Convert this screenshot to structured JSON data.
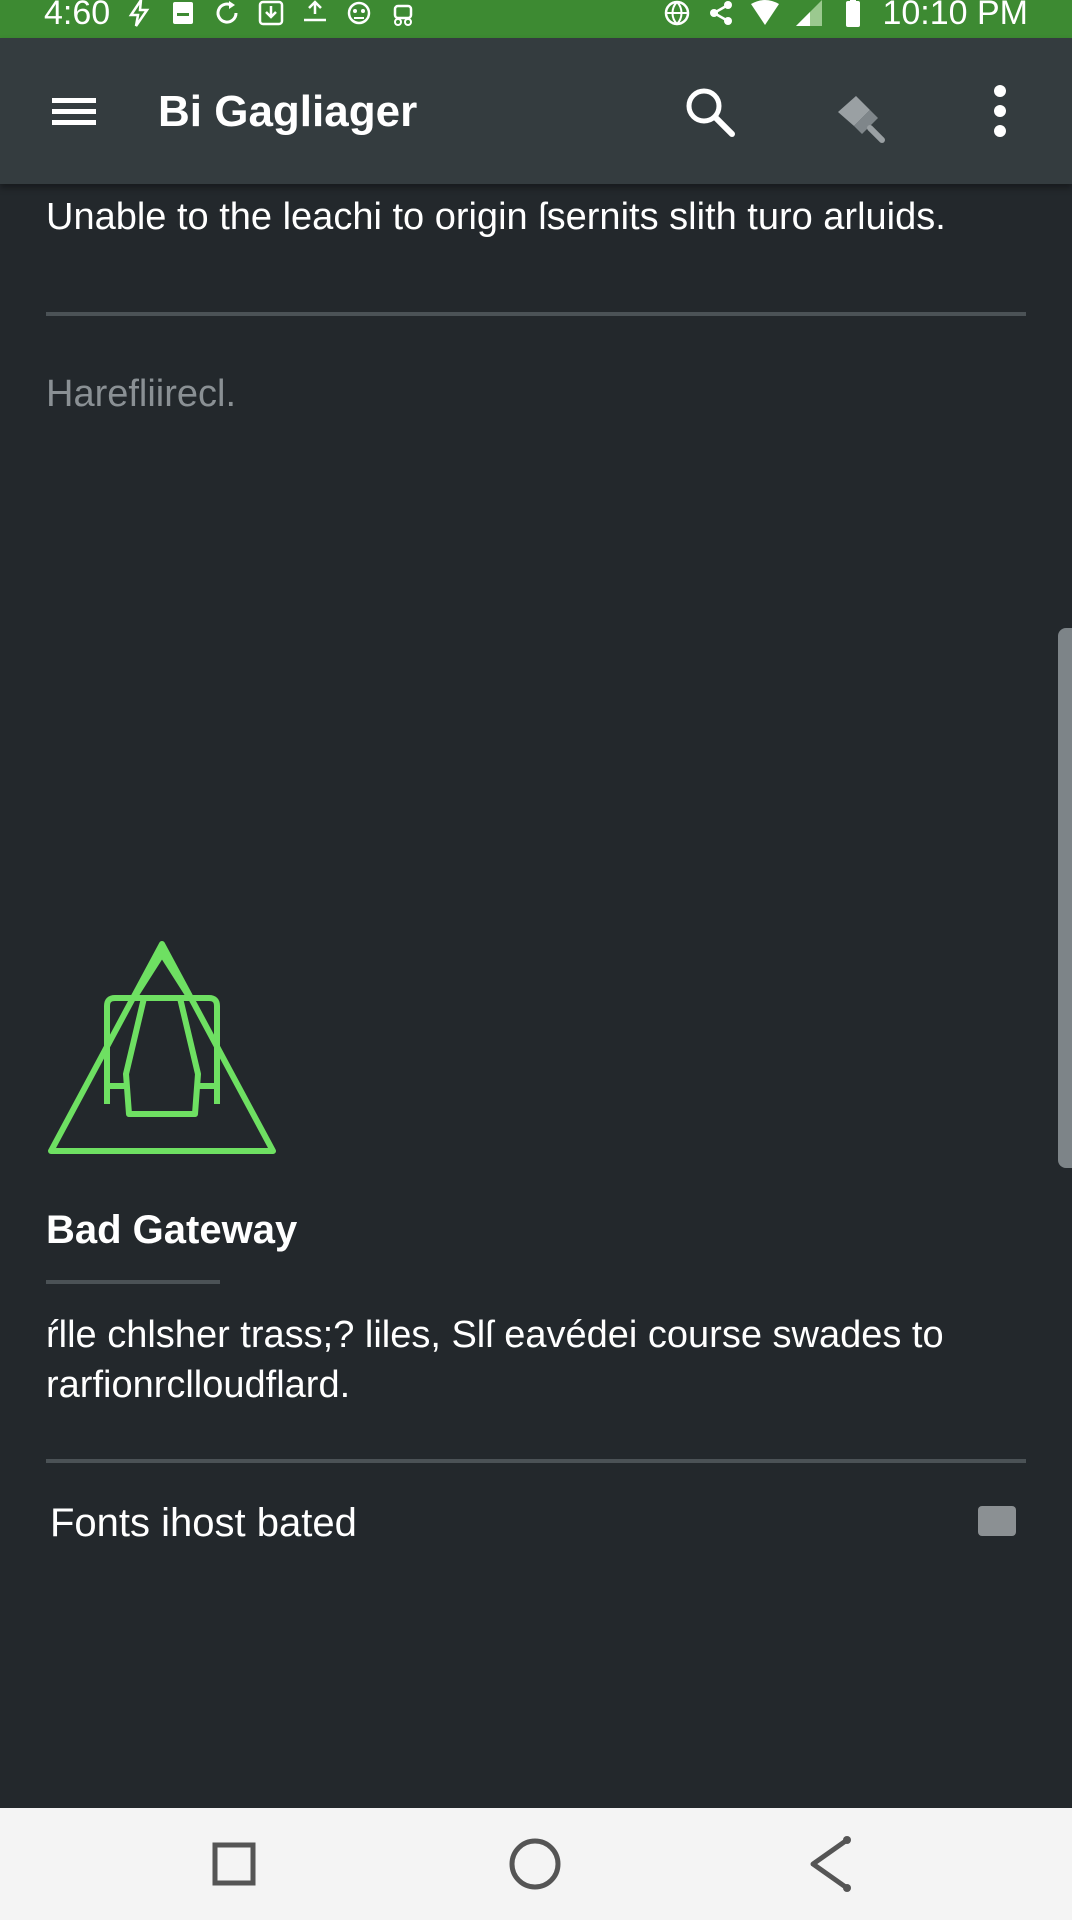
{
  "status_bar": {
    "left_time": "4:60",
    "right_time": "10:10 PM",
    "left_icons": [
      "flash-icon",
      "sim-card-icon",
      "sync-icon",
      "download-icon",
      "upload-icon",
      "game-controller-icon",
      "android-robot-icon"
    ],
    "right_icons": [
      "globe-icon",
      "share-icon",
      "wifi-icon",
      "cellular-signal-icon",
      "battery-icon"
    ],
    "background_color": "#3d8a32"
  },
  "app_bar": {
    "title": "Bi Gagliager",
    "menu_icon": "hamburger-menu-icon",
    "actions": [
      "search-icon",
      "brush-icon",
      "more-vert-icon"
    ],
    "background_color": "#343c3f"
  },
  "content": {
    "top_message": "Unable to the leachi to origin ſsernits slith turo arluids.",
    "muted_label": "Harefliirecl.",
    "warning_icon": "warning-triangle-icon",
    "accent_color": "#6ee062",
    "error_title": "Bad Gateway",
    "error_body": "ŕlle chlsher trass;? liles, Slſ eavédei course swades to rarfionrclloudflard.",
    "option": {
      "label": "Fonts ihost bated",
      "checked": false
    }
  },
  "nav_bar": {
    "buttons": [
      "recents-icon",
      "home-icon",
      "back-share-icon"
    ],
    "background_color": "#f4f4f4"
  }
}
